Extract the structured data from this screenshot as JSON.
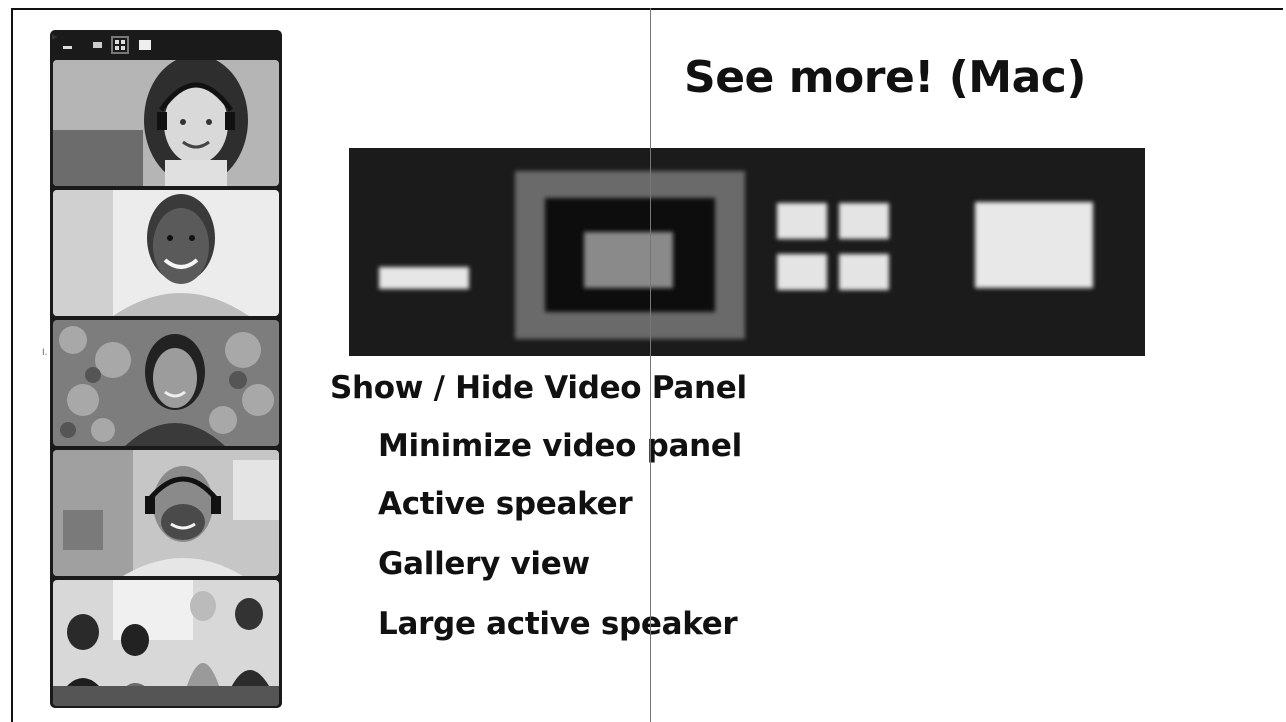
{
  "title": "See more! (Mac)",
  "video_panel": {
    "toolbar_icons": [
      "minimize-icon",
      "active-speaker-icon",
      "gallery-view-icon",
      "large-speaker-icon"
    ],
    "participants": [
      {
        "icon": "participant-video-headset-woman"
      },
      {
        "icon": "participant-video-smiling-man"
      },
      {
        "icon": "participant-video-woman-foliage"
      },
      {
        "icon": "participant-video-headset-man"
      },
      {
        "icon": "participant-video-group-meeting"
      }
    ]
  },
  "zoomed_toolbar": {
    "icons": [
      "minimize-icon",
      "active-speaker-icon",
      "gallery-view-icon",
      "large-active-speaker-icon"
    ],
    "background": "#1b1b1b"
  },
  "labels": {
    "main": "Show / Hide Video Panel",
    "minimize": "Minimize video panel",
    "active_speaker": "Active speaker",
    "gallery": "Gallery view",
    "large_active": "Large active speaker"
  }
}
